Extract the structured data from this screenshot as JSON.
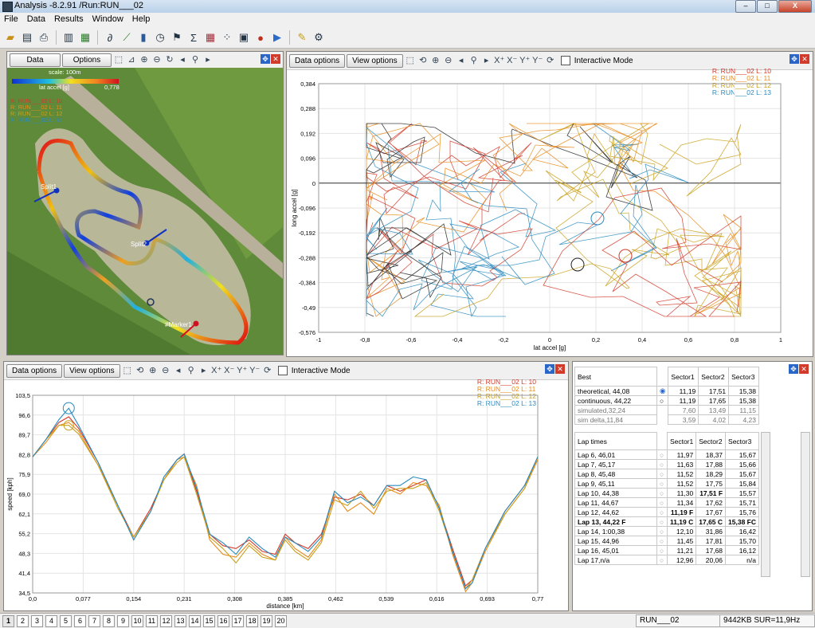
{
  "window": {
    "title": "Analysis -8.2.91 /Run:RUN___02",
    "minimize": "–",
    "maximize": "□",
    "close": "X"
  },
  "menu": [
    "File",
    "Data",
    "Results",
    "Window",
    "Help"
  ],
  "toolbar_icons": [
    "open-icon",
    "import-icon",
    "print-icon",
    "clipboard-icon",
    "save-icon",
    "track-icon",
    "line-chart-icon",
    "bar-chart-icon",
    "stopwatch-icon",
    "checkered-flag-icon",
    "sigma-icon",
    "grid-icon",
    "scatter-icon",
    "gauge-icon",
    "record-icon",
    "play-icon",
    "note-icon",
    "settings-icon"
  ],
  "map_panel": {
    "data_btn": "Data",
    "options_btn": "Options",
    "scale": "scale: 100m",
    "colorbar_label": "lat accel [g]",
    "colorbar_max": "0,778",
    "legend": [
      "R: RUN___02 L: 10",
      "R: RUN___02 L: 11",
      "R: RUN___02 L: 12",
      "R: RUN___02 L: 13"
    ],
    "markers": [
      "Split1",
      "Split2",
      "#Marker1"
    ]
  },
  "gg_panel": {
    "data_options": "Data options",
    "view_options": "View options",
    "interactive": "Interactive Mode",
    "xlabel": "lat accel [g]",
    "ylabel": "long accel [g]",
    "legend": [
      "R: RUN___02 L: 10",
      "R: RUN___02 L: 11",
      "R: RUN___02 L: 12",
      "R: RUN___02 L: 13"
    ],
    "yticks": [
      "0,384",
      "0,288",
      "0,192",
      "0,096",
      "0",
      "-0,096",
      "-0,192",
      "-0,288",
      "-0,384",
      "-0,49",
      "-0,576"
    ],
    "xticks": [
      "-1",
      "-0,8",
      "-0,6",
      "-0,4",
      "-0,2",
      "0",
      "0,2",
      "0,4",
      "0,6",
      "0,8",
      "1"
    ]
  },
  "speed_panel": {
    "data_options": "Data options",
    "view_options": "View options",
    "interactive": "Interactive Mode",
    "legend": [
      "R: RUN___02 L: 10",
      "R: RUN___02 L: 11",
      "R: RUN___02 L: 12",
      "R: RUN___02 L: 13"
    ]
  },
  "chart_data": {
    "type": "line",
    "xlabel": "distance [km]",
    "ylabel": "speed [kph]",
    "xlim": [
      0,
      0.77
    ],
    "ylim": [
      34.5,
      103.5
    ],
    "xticks": [
      "0,0",
      "0,077",
      "0,154",
      "0,231",
      "0,308",
      "0,385",
      "0,462",
      "0,539",
      "0,616",
      "0,693",
      "0,77"
    ],
    "yticks": [
      "103,5",
      "96,6",
      "89,7",
      "82,8",
      "75,9",
      "69,0",
      "62,1",
      "55,2",
      "48,3",
      "41,4",
      "34,5"
    ],
    "x": [
      0,
      0.02,
      0.04,
      0.055,
      0.07,
      0.1,
      0.13,
      0.154,
      0.18,
      0.2,
      0.22,
      0.231,
      0.25,
      0.27,
      0.29,
      0.31,
      0.33,
      0.35,
      0.37,
      0.385,
      0.4,
      0.42,
      0.44,
      0.46,
      0.48,
      0.5,
      0.52,
      0.54,
      0.56,
      0.58,
      0.6,
      0.62,
      0.64,
      0.66,
      0.67,
      0.69,
      0.72,
      0.75,
      0.77
    ],
    "series": [
      {
        "name": "R: RUN___02 L: 10",
        "color": "#d23a2a",
        "values": [
          82,
          88,
          94,
          96,
          92,
          80,
          65,
          54,
          64,
          74,
          81,
          83,
          70,
          55,
          51,
          50,
          53,
          49,
          48,
          55,
          52,
          50,
          55,
          68,
          67,
          69,
          65,
          72,
          70,
          72,
          74,
          64,
          50,
          37,
          39,
          50,
          63,
          72,
          82
        ]
      },
      {
        "name": "R: RUN___02 L: 11",
        "color": "#e88a1a",
        "values": [
          82,
          87,
          93,
          94,
          91,
          79,
          65,
          53,
          63,
          74,
          81,
          82,
          72,
          53,
          48,
          47,
          52,
          48,
          46,
          54,
          50,
          47,
          53,
          69,
          63,
          66,
          62,
          71,
          69,
          73,
          72,
          65,
          48,
          35,
          38,
          49,
          62,
          71,
          81
        ]
      },
      {
        "name": "R: RUN___02 L: 12",
        "color": "#c9a01a",
        "values": [
          82,
          88,
          93,
          93,
          90,
          79,
          64,
          54,
          63,
          74,
          80,
          82,
          69,
          54,
          50,
          45,
          51,
          47,
          46,
          53,
          49,
          46,
          52,
          67,
          65,
          70,
          64,
          70,
          71,
          71,
          73,
          63,
          49,
          36,
          39,
          50,
          62,
          71,
          82
        ]
      },
      {
        "name": "R: RUN___02 L: 13",
        "color": "#2a8bbf",
        "values": [
          82,
          88,
          95,
          99,
          93,
          80,
          65,
          53,
          63,
          75,
          81,
          83,
          71,
          55,
          52,
          48,
          54,
          50,
          47,
          54,
          52,
          49,
          54,
          70,
          66,
          68,
          65,
          72,
          72,
          75,
          74,
          64,
          49,
          36,
          38,
          50,
          63,
          72,
          82
        ]
      }
    ]
  },
  "best_table": {
    "headers": [
      "Best",
      "Sector1",
      "Sector2",
      "Sector3"
    ],
    "rows": [
      [
        "theoretical, 44,08",
        "11,19",
        "17,51",
        "15,38"
      ],
      [
        "continuous, 44,22",
        "11,19",
        "17,65",
        "15,38"
      ],
      [
        "simulated,32,24",
        "7,60",
        "13,49",
        "11,15"
      ],
      [
        "sim delta,11,84",
        "3,59",
        "4,02",
        "4,23"
      ]
    ]
  },
  "lap_table": {
    "headers": [
      "Lap times",
      "Sector1",
      "Sector2",
      "Sector3"
    ],
    "rows": [
      [
        "Lap 6, 46,01",
        "11,97",
        "18,37",
        "15,67"
      ],
      [
        "Lap 7, 45,17",
        "11,63",
        "17,88",
        "15,66"
      ],
      [
        "Lap 8, 45,48",
        "11,52",
        "18,29",
        "15,67"
      ],
      [
        "Lap 9, 45,11",
        "11,52",
        "17,75",
        "15,84"
      ],
      [
        "Lap 10, 44,38",
        "11,30",
        "17,51 F",
        "15,57"
      ],
      [
        "Lap 11, 44,67",
        "11,34",
        "17,62",
        "15,71"
      ],
      [
        "Lap 12, 44,62",
        "11,19 F",
        "17,67",
        "15,76"
      ],
      [
        "Lap 13, 44,22 F",
        "11,19 C",
        "17,65 C",
        "15,38 FC"
      ],
      [
        "Lap 14, 1:00,38",
        "12,10",
        "31,86",
        "16,42"
      ],
      [
        "Lap 15, 44,96",
        "11,45",
        "17,81",
        "15,70"
      ],
      [
        "Lap 16, 45,01",
        "11,21",
        "17,68",
        "16,12"
      ],
      [
        "Lap 17,n/a",
        "12,96",
        "20,06",
        "n/a"
      ]
    ]
  },
  "page_tabs": [
    "1",
    "2",
    "3",
    "4",
    "5",
    "6",
    "7",
    "8",
    "9",
    "10",
    "11",
    "12",
    "13",
    "14",
    "15",
    "16",
    "17",
    "18",
    "19",
    "20"
  ],
  "status": {
    "run": "RUN___02",
    "info": "9442KB SUR=11,9Hz"
  }
}
